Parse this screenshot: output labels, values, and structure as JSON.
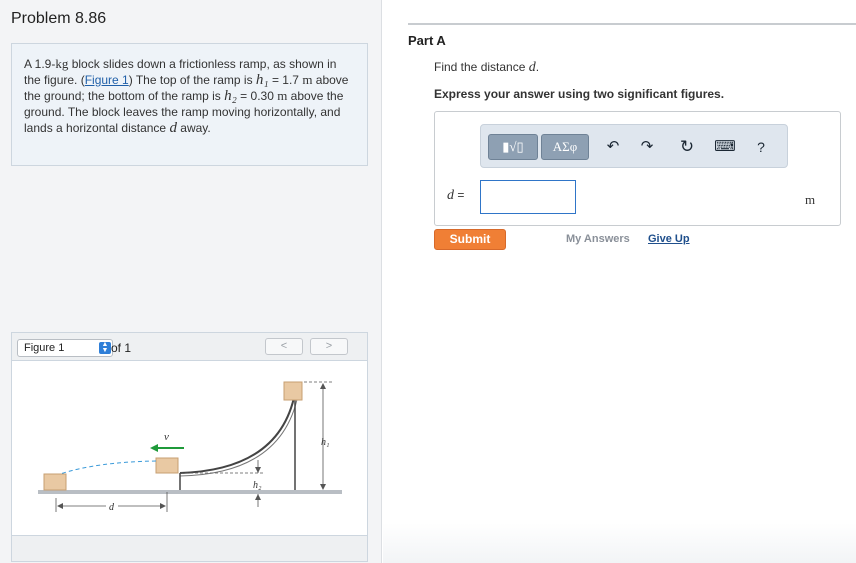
{
  "problem": {
    "title": "Problem 8.86",
    "statement": {
      "p1": "A 1.9-",
      "unit_kg": "kg",
      "p2": " block slides down a frictionless ramp, as shown in the figure. (",
      "figure_link": "Figure 1",
      "p3": ") The top of the ramp is ",
      "h1": "h₁",
      "p4": " = 1.7 ",
      "unit_m1": "m",
      "p5": " above the ground; the bottom of the ramp is ",
      "h2": "h₂",
      "p6": " = 0.30 ",
      "unit_m2": "m",
      "p7": " above the ground. The block leaves the ramp moving horizontally, and lands a horizontal distance ",
      "d": "d",
      "p8": " away."
    }
  },
  "figure": {
    "selected": "Figure 1",
    "of_label": "of 1",
    "prev_glyph": "<",
    "next_glyph": ">",
    "labels": {
      "velocity": "v⃗",
      "h1": "h₁",
      "h2": "h₂",
      "d": "d"
    },
    "colors": {
      "arrow": "#1f9a3a",
      "trajectory": "#3a9ad9",
      "block": "#e9c9a3",
      "ground": "#b9bec4"
    }
  },
  "part": {
    "title": "Part A",
    "prompt_prefix": "Find the distance ",
    "prompt_var": "d",
    "prompt_suffix": ".",
    "instruction": "Express your answer using two significant figures.",
    "toolbar": {
      "templates_glyph": "▮√▯",
      "symbols_label": "ΑΣφ",
      "undo_glyph": "↶",
      "redo_glyph": "↷",
      "reset_glyph": "↻",
      "keyboard_glyph": "⌨",
      "help_glyph": "?"
    },
    "equation_var": "d",
    "equation_eq": " =",
    "answer_value": "",
    "unit": "m",
    "submit_label": "Submit",
    "my_answers_label": "My Answers",
    "give_up_label": "Give Up"
  }
}
